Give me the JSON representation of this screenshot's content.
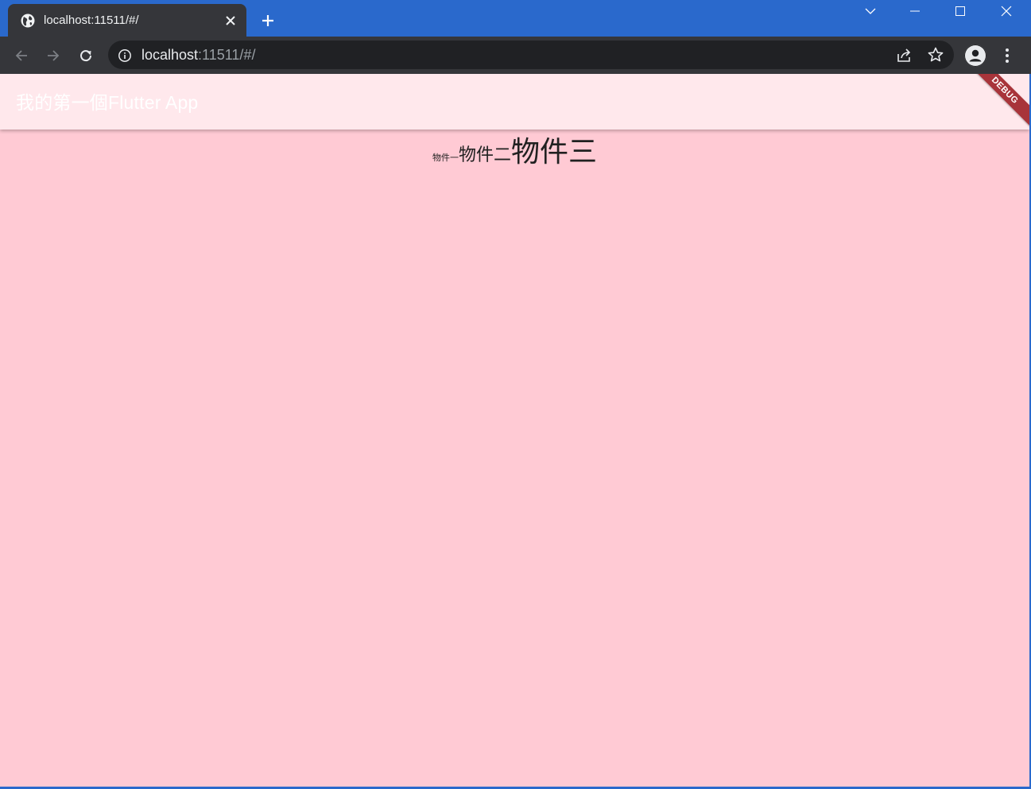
{
  "browser": {
    "tab": {
      "title": "localhost:11511/#/",
      "favicon": "globe-icon"
    },
    "address_bar": {
      "host": "localhost",
      "path": ":11511/#/"
    },
    "colors": {
      "frame": "#2a69cc",
      "toolbar": "#35363a",
      "omnibox": "#202124"
    }
  },
  "app": {
    "title": "我的第一個Flutter App",
    "background": "#ffcad4",
    "appbar_color": "#ffe8ec",
    "debug_banner": "DEBUG",
    "items": [
      {
        "label": "物件一"
      },
      {
        "label": "物件二"
      },
      {
        "label": "物件三"
      }
    ]
  }
}
